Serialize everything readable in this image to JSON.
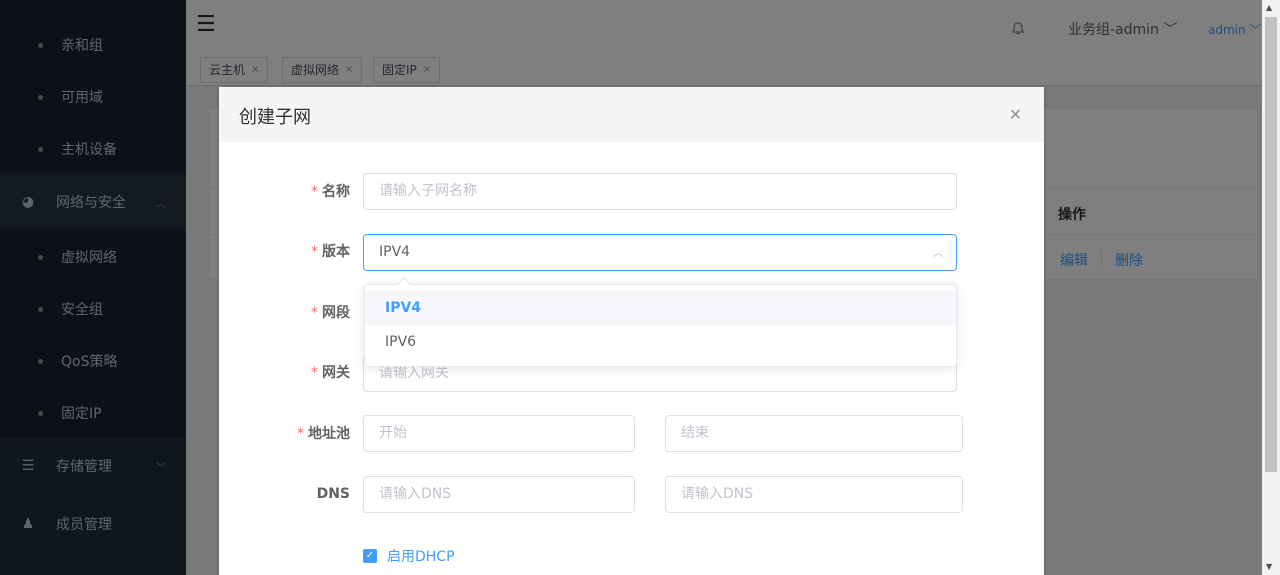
{
  "sidebar": {
    "items": [
      {
        "label": "亲和组"
      },
      {
        "label": "可用域"
      },
      {
        "label": "主机设备"
      },
      {
        "label": "网络与安全"
      },
      {
        "label": "虚拟网络"
      },
      {
        "label": "安全组"
      },
      {
        "label": "QoS策略"
      },
      {
        "label": "固定IP"
      },
      {
        "label": "存储管理"
      },
      {
        "label": "成员管理"
      }
    ]
  },
  "header": {
    "group": "业务组-admin ﹀",
    "user": "admin ﹀"
  },
  "tags": [
    {
      "label": "云主机"
    },
    {
      "label": "虚拟网络"
    },
    {
      "label": "固定IP"
    }
  ],
  "table": {
    "op_header": "操作",
    "edit": "编辑",
    "delete": "删除"
  },
  "dialog": {
    "title": "创建子网",
    "fields": {
      "name_label": "名称",
      "name_placeholder": "请输入子网名称",
      "version_label": "版本",
      "version_value": "IPV4",
      "segment_label": "网段",
      "gateway_label": "网关",
      "gateway_placeholder": "请输入网关",
      "pool_label": "地址池",
      "pool_start": "开始",
      "pool_end": "结束",
      "dns_label": "DNS",
      "dns_placeholder1": "请输入DNS",
      "dns_placeholder2": "请输入DNS"
    },
    "version_options": [
      "IPV4",
      "IPV6"
    ],
    "dhcp_label": "启用DHCP"
  },
  "colors": {
    "primary": "#409eff",
    "sidebar_bg": "#1f2d3d",
    "required": "#f56c6c"
  }
}
